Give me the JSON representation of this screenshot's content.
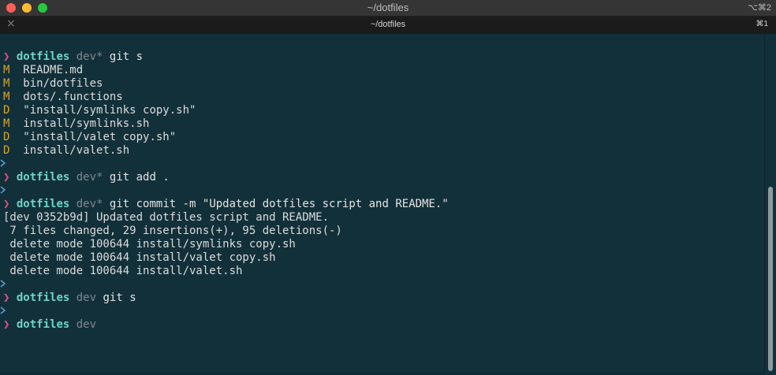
{
  "window": {
    "title": "~/dotfiles",
    "shortcut": "⌥⌘2"
  },
  "tab": {
    "close_icon": "close-icon",
    "title": "~/dotfiles",
    "shortcut": "⌘1"
  },
  "prompt": {
    "symbol": "❯",
    "dir": "dotfiles"
  },
  "lines": {
    "p1": {
      "branch": "dev*",
      "cmd": " git s"
    },
    "s1": {
      "code": "M",
      "path": "  README.md"
    },
    "s2": {
      "code": "M",
      "path": "  bin/dotfiles"
    },
    "s3": {
      "code": "M",
      "path": "  dots/.functions"
    },
    "s4": {
      "code": "D",
      "path": "  \"install/symlinks copy.sh\""
    },
    "s5": {
      "code": "M",
      "path": "  install/symlinks.sh"
    },
    "s6": {
      "code": "D",
      "path": "  \"install/valet copy.sh\""
    },
    "s7": {
      "code": "D",
      "path": "  install/valet.sh"
    },
    "p2": {
      "branch": "dev*",
      "cmd": " git add ."
    },
    "p3": {
      "branch": "dev*",
      "cmd": " git commit -m \"Updated dotfiles script and README.\""
    },
    "o1": "[dev 0352b9d] Updated dotfiles script and README.",
    "o2": " 7 files changed, 29 insertions(+), 95 deletions(-)",
    "o3": " delete mode 100644 install/symlinks copy.sh",
    "o4": " delete mode 100644 install/valet copy.sh",
    "o5": " delete mode 100644 install/valet.sh",
    "p4": {
      "branch": "dev",
      "cmd": " git s"
    },
    "p5": {
      "branch": "dev",
      "cmd": ""
    }
  },
  "colors": {
    "background": "#12303a",
    "prompt_caret": "#e1508a",
    "dir": "#6fd4c3",
    "branch": "#7f8891",
    "status_code": "#d9a32b",
    "marker": "#5b9bd5"
  }
}
